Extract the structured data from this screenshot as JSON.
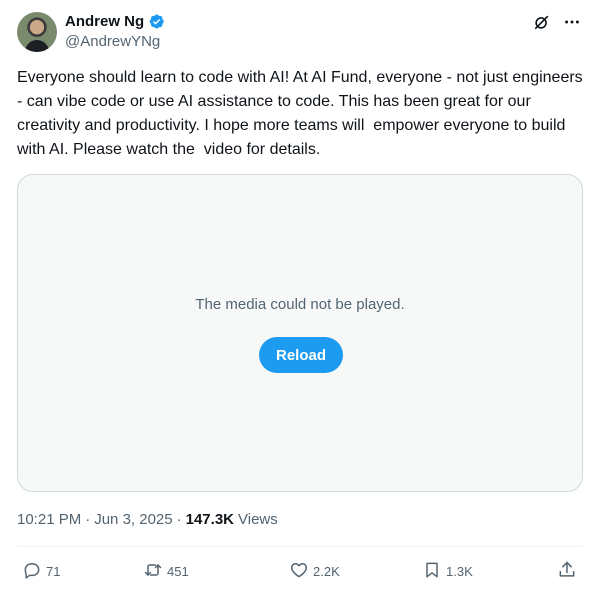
{
  "author": {
    "display_name": "Andrew Ng",
    "handle": "@AndrewYNg",
    "verified": true,
    "verified_color": "#1d9bf0"
  },
  "tweet": {
    "text": "Everyone should learn to code with AI! At AI Fund, everyone - not just engineers - can vibe code or use AI assistance to code. This has been great for our creativity and productivity. I hope more teams will  empower everyone to build with AI. Please watch the  video for details."
  },
  "media": {
    "error_message": "The media could not be played.",
    "reload_label": "Reload"
  },
  "meta": {
    "time": "10:21 PM",
    "date": "Jun 3, 2025",
    "views_count": "147.3K",
    "views_label": "Views",
    "separator": "·"
  },
  "actions": {
    "replies": "71",
    "reposts": "451",
    "likes": "2.2K",
    "bookmarks": "1.3K"
  },
  "icons": {
    "top": [
      "grok-icon",
      "more-icon"
    ],
    "actions": [
      "reply-icon",
      "repost-icon",
      "like-icon",
      "bookmark-icon",
      "share-icon"
    ]
  },
  "colors": {
    "accent": "#1d9bf0",
    "text": "#0f1419",
    "secondary": "#536471"
  }
}
